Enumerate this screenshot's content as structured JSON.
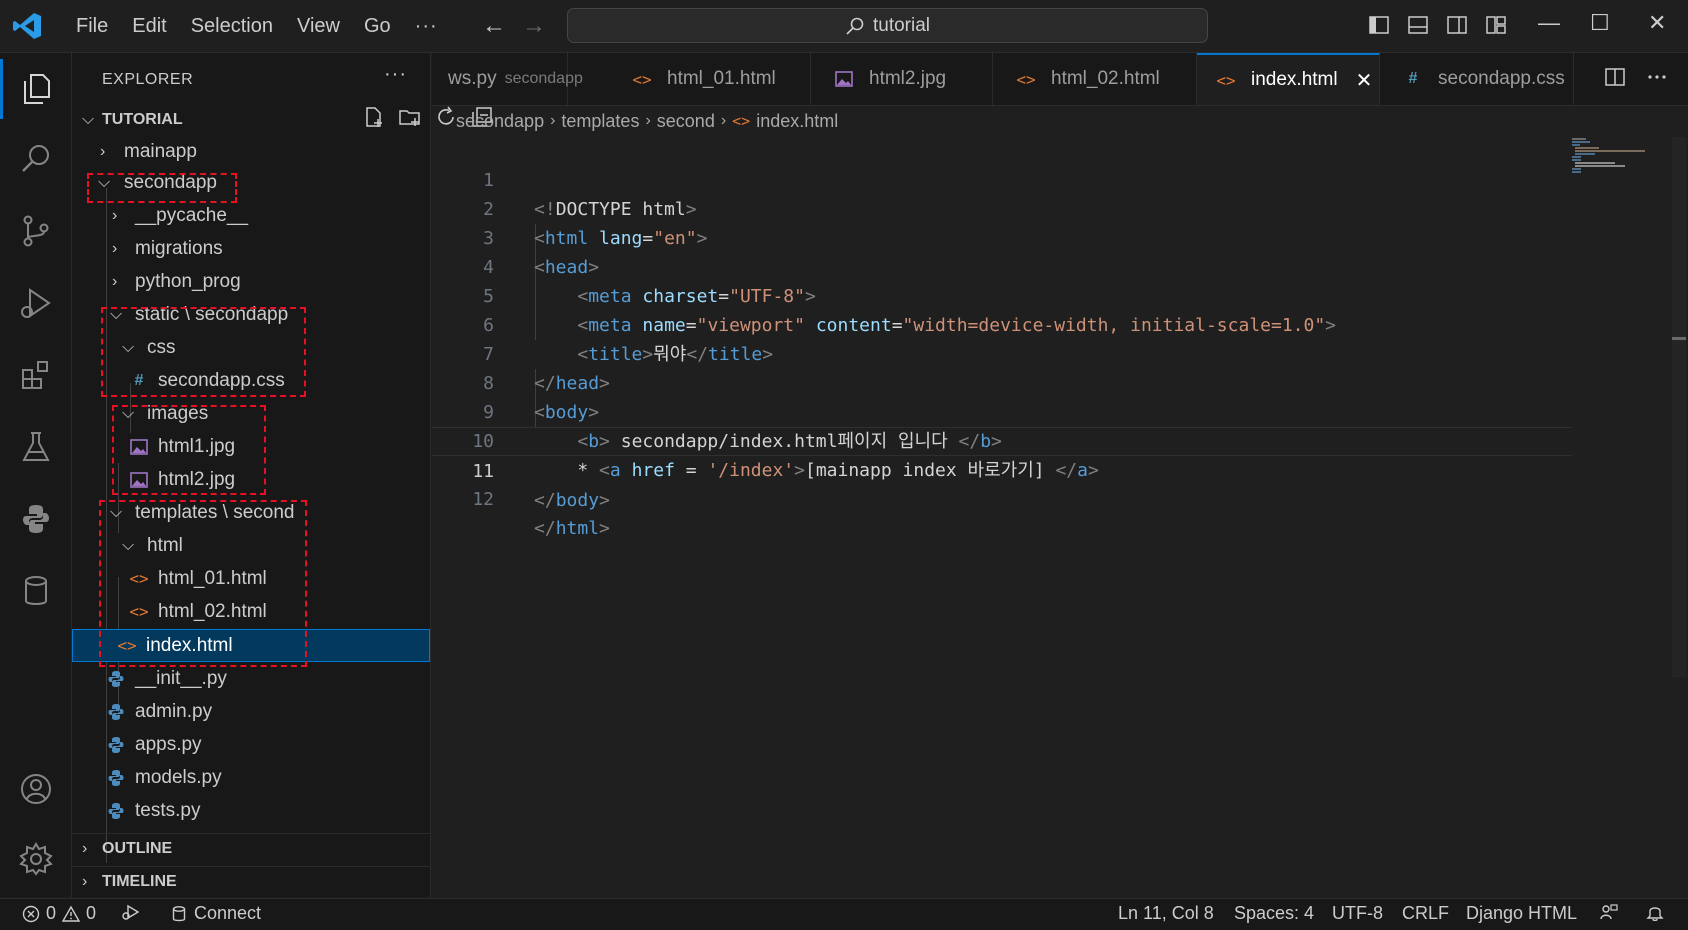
{
  "titlebar": {
    "menu": [
      "File",
      "Edit",
      "Selection",
      "View",
      "Go"
    ],
    "more": "···",
    "search_text": "tutorial"
  },
  "sidebar": {
    "title": "EXPLORER",
    "more": "···",
    "section": "TUTORIAL",
    "tree": [
      {
        "label": "mainapp",
        "kind": "folder",
        "open": false
      },
      {
        "label": "secondapp",
        "kind": "folder",
        "open": true
      },
      {
        "label": "__pycache__",
        "kind": "folder",
        "open": false
      },
      {
        "label": "migrations",
        "kind": "folder",
        "open": false
      },
      {
        "label": "python_prog",
        "kind": "folder",
        "open": false
      },
      {
        "label": "static \\ secondapp",
        "kind": "folder",
        "open": true
      },
      {
        "label": "css",
        "kind": "folder",
        "open": true
      },
      {
        "label": "secondapp.css",
        "kind": "css"
      },
      {
        "label": "images",
        "kind": "folder",
        "open": true
      },
      {
        "label": "html1.jpg",
        "kind": "image"
      },
      {
        "label": "html2.jpg",
        "kind": "image"
      },
      {
        "label": "templates \\ second",
        "kind": "folder",
        "open": true
      },
      {
        "label": "html",
        "kind": "folder",
        "open": true
      },
      {
        "label": "html_01.html",
        "kind": "html"
      },
      {
        "label": "html_02.html",
        "kind": "html"
      },
      {
        "label": "index.html",
        "kind": "html",
        "selected": true
      },
      {
        "label": "__init__.py",
        "kind": "python"
      },
      {
        "label": "admin.py",
        "kind": "python"
      },
      {
        "label": "apps.py",
        "kind": "python"
      },
      {
        "label": "models.py",
        "kind": "python"
      },
      {
        "label": "tests.py",
        "kind": "python"
      }
    ],
    "outline": "OUTLINE",
    "timeline": "TIMELINE"
  },
  "tabs": [
    {
      "label": "ws.py",
      "desc": "secondapp",
      "kind": "python"
    },
    {
      "label": "html_01.html",
      "kind": "html"
    },
    {
      "label": "html2.jpg",
      "kind": "image"
    },
    {
      "label": "html_02.html",
      "kind": "html"
    },
    {
      "label": "index.html",
      "kind": "html",
      "active": true
    },
    {
      "label": "secondapp.css",
      "kind": "css"
    }
  ],
  "tab_close": "✕",
  "breadcrumb": [
    "secondapp",
    "templates",
    "second",
    "index.html"
  ],
  "editor": {
    "current_line": 11,
    "lines": [
      {
        "n": "1"
      },
      {
        "n": "2"
      },
      {
        "n": "3"
      },
      {
        "n": "4"
      },
      {
        "n": "5"
      },
      {
        "n": "6"
      },
      {
        "n": "7"
      },
      {
        "n": "8"
      },
      {
        "n": "9"
      },
      {
        "n": "10"
      },
      {
        "n": "11"
      },
      {
        "n": "12"
      }
    ],
    "code": {
      "doctype": "DOCTYPE html",
      "html": "html",
      "lang_attr": "lang",
      "lang_val": "\"en\"",
      "head": "head",
      "meta": "meta",
      "charset_attr": "charset",
      "charset_val": "\"UTF-8\"",
      "name_attr": "name",
      "name_val": "\"viewport\"",
      "content_attr": "content",
      "content_val": "\"width=device-width, initial-scale=1.0\"",
      "title": "title",
      "title_text": "뭐야",
      "body": "body",
      "b": "b",
      "b_text": " secondapp/index.html페이지 입니다 ",
      "star": "* ",
      "a": "a",
      "href_attr": "href",
      "href_val": "'/index'",
      "a_text": "[mainapp index 바로가기] "
    }
  },
  "statusbar": {
    "errors": "0",
    "warnings": "0",
    "connect": "Connect",
    "position": "Ln 11, Col 8",
    "spaces": "Spaces: 4",
    "encoding": "UTF-8",
    "eol": "CRLF",
    "language": "Django HTML"
  },
  "colors": {
    "accent": "#0078d4",
    "annotation_box": "#e81123",
    "html_icon": "#e37933",
    "css_icon": "#519aba",
    "python_icon": "#4b8bbe",
    "image_icon": "#a074c4"
  }
}
